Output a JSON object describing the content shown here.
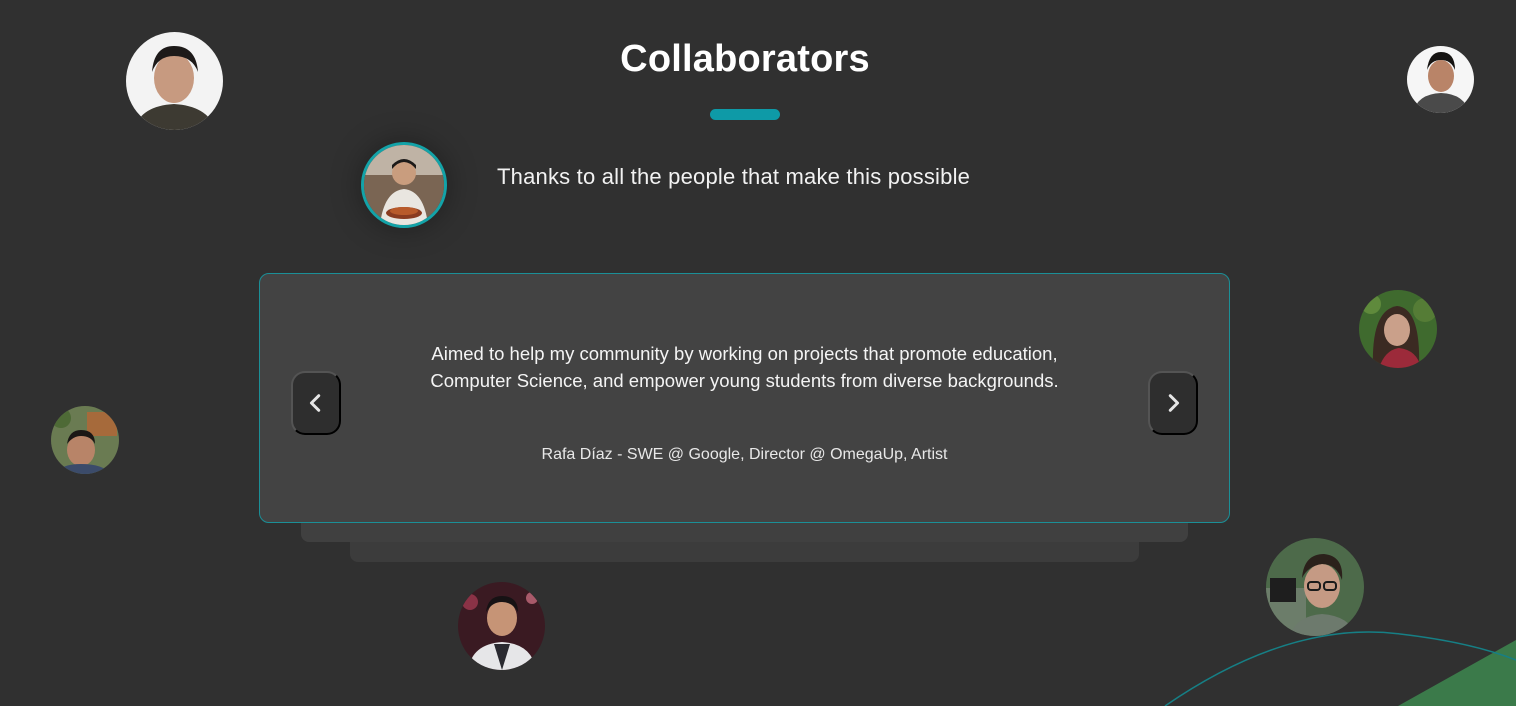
{
  "header": {
    "title": "Collaborators"
  },
  "intro": {
    "subtitle": "Thanks to all the people that make this possible"
  },
  "testimonial": {
    "quote_line_1": "Aimed to help my community by working on projects that promote education,",
    "quote_line_2": "Computer Science, and empower young students from diverse backgrounds.",
    "author": "Rafa Díaz - SWE @ Google, Director @ OmegaUp, Artist"
  },
  "navigation": {
    "prev_icon": "chevron-left-icon",
    "next_icon": "chevron-right-icon"
  },
  "colors": {
    "background": "#303030",
    "accent": "#0e9aa7",
    "card": "#434343",
    "card_border": "#1b8f97",
    "decor_green": "#3b7a4a"
  }
}
